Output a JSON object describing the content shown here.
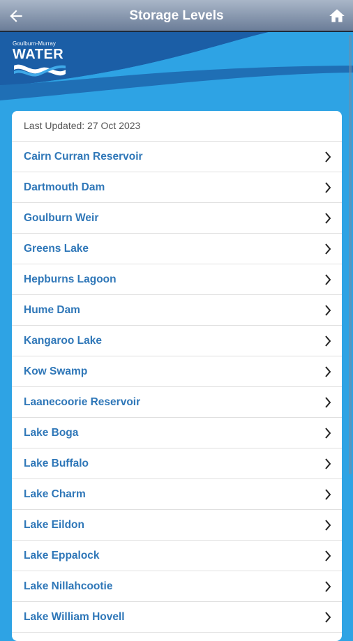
{
  "header": {
    "title": "Storage Levels",
    "back_icon": "arrow-left-icon",
    "home_icon": "home-icon"
  },
  "brand": {
    "line1": "Goulburn-Murray",
    "line2": "WATER"
  },
  "list": {
    "last_updated": "Last Updated: 27 Oct 2023",
    "items": [
      {
        "label": "Cairn Curran Reservoir"
      },
      {
        "label": "Dartmouth Dam"
      },
      {
        "label": "Goulburn Weir"
      },
      {
        "label": "Greens Lake"
      },
      {
        "label": "Hepburns Lagoon"
      },
      {
        "label": "Hume Dam"
      },
      {
        "label": "Kangaroo Lake"
      },
      {
        "label": "Kow Swamp"
      },
      {
        "label": "Laanecoorie Reservoir"
      },
      {
        "label": "Lake Boga"
      },
      {
        "label": "Lake Buffalo"
      },
      {
        "label": "Lake Charm"
      },
      {
        "label": "Lake Eildon"
      },
      {
        "label": "Lake Eppalock"
      },
      {
        "label": "Lake Nillahcootie"
      },
      {
        "label": "Lake William Hovell"
      }
    ]
  },
  "colors": {
    "background": "#2ea3e4",
    "link": "#2f77b8",
    "banner_dark": "#1a5fa8"
  }
}
